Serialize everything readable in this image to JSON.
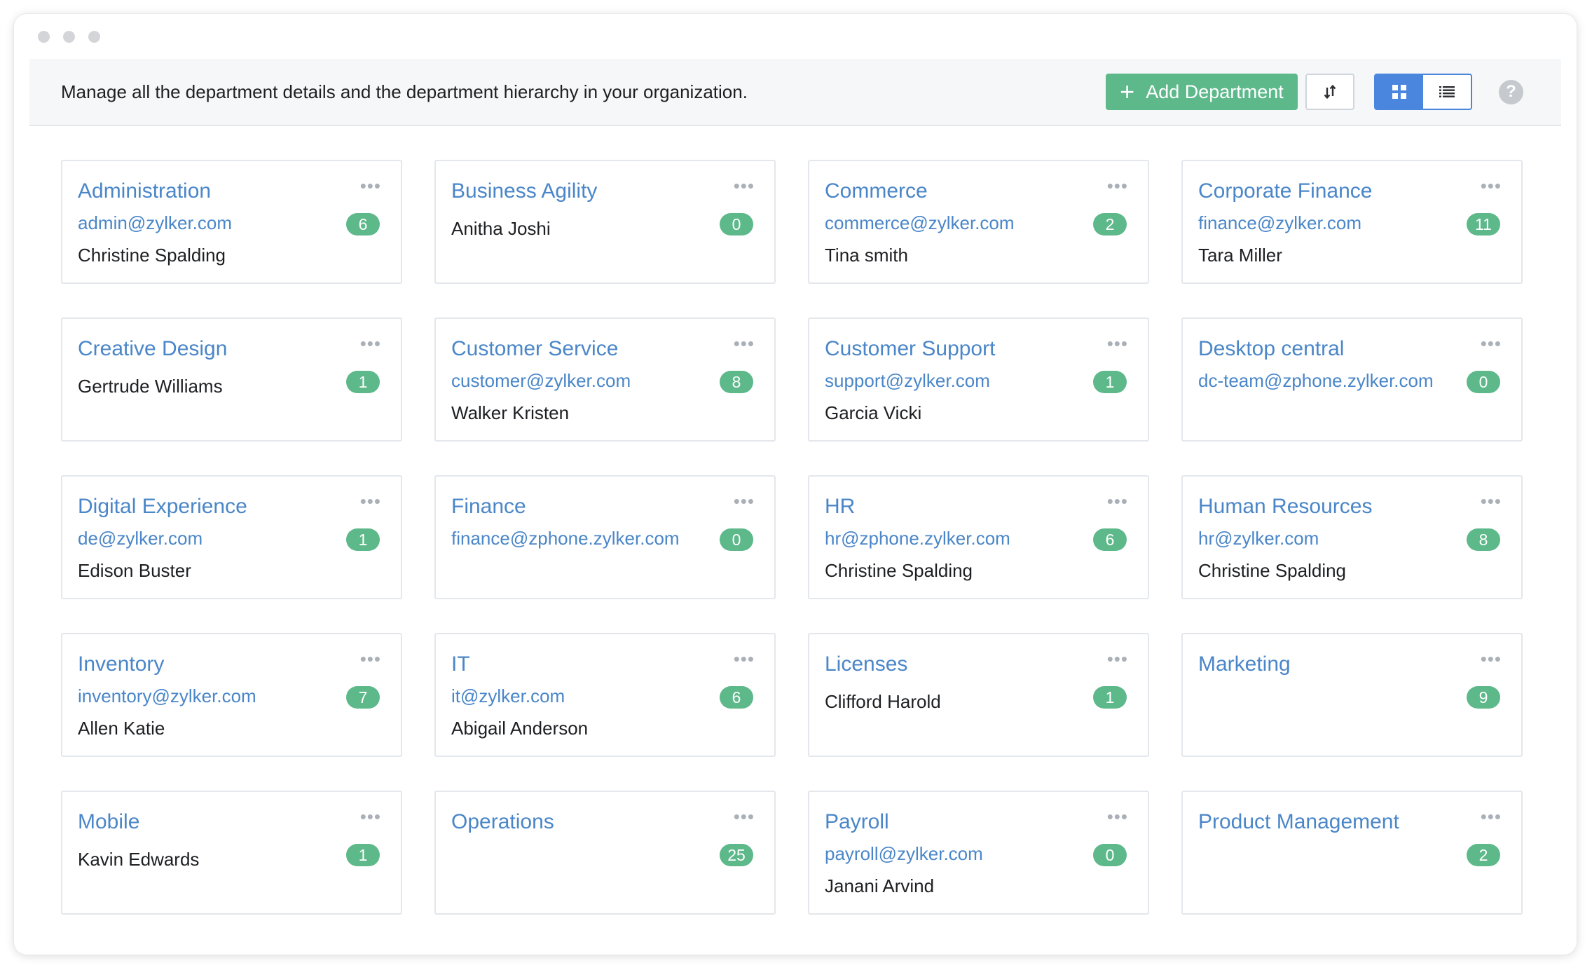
{
  "toolbar": {
    "description": "Manage all the department details and the department hierarchy in your organization.",
    "add_label": "Add Department",
    "help_label": "?"
  },
  "departments": [
    {
      "name": "Administration",
      "email": "admin@zylker.com",
      "head": "Christine Spalding",
      "count": "6"
    },
    {
      "name": "Business Agility",
      "email": "",
      "head": "Anitha Joshi",
      "count": "0"
    },
    {
      "name": "Commerce",
      "email": "commerce@zylker.com",
      "head": "Tina smith",
      "count": "2"
    },
    {
      "name": "Corporate Finance",
      "email": "finance@zylker.com",
      "head": "Tara Miller",
      "count": "11"
    },
    {
      "name": "Creative Design",
      "email": "",
      "head": "Gertrude Williams",
      "count": "1"
    },
    {
      "name": "Customer Service",
      "email": "customer@zylker.com",
      "head": "Walker Kristen",
      "count": "8"
    },
    {
      "name": "Customer Support",
      "email": "support@zylker.com",
      "head": "Garcia Vicki",
      "count": "1"
    },
    {
      "name": "Desktop central",
      "email": "dc-team@zphone.zylker.com",
      "head": "",
      "count": "0"
    },
    {
      "name": "Digital Experience",
      "email": "de@zylker.com",
      "head": "Edison Buster",
      "count": "1"
    },
    {
      "name": "Finance",
      "email": "finance@zphone.zylker.com",
      "head": "",
      "count": "0"
    },
    {
      "name": "HR",
      "email": "hr@zphone.zylker.com",
      "head": "Christine Spalding",
      "count": "6"
    },
    {
      "name": "Human Resources",
      "email": "hr@zylker.com",
      "head": "Christine Spalding",
      "count": "8"
    },
    {
      "name": "Inventory",
      "email": "inventory@zylker.com",
      "head": "Allen Katie",
      "count": "7"
    },
    {
      "name": "IT",
      "email": "it@zylker.com",
      "head": "Abigail Anderson",
      "count": "6"
    },
    {
      "name": "Licenses",
      "email": "",
      "head": "Clifford Harold",
      "count": "1"
    },
    {
      "name": "Marketing",
      "email": "",
      "head": "",
      "count": "9"
    },
    {
      "name": "Mobile",
      "email": "",
      "head": "Kavin Edwards",
      "count": "1"
    },
    {
      "name": "Operations",
      "email": "",
      "head": "",
      "count": "25"
    },
    {
      "name": "Payroll",
      "email": "payroll@zylker.com",
      "head": "Janani Arvind",
      "count": "0"
    },
    {
      "name": "Product Management",
      "email": "",
      "head": "",
      "count": "2"
    }
  ]
}
